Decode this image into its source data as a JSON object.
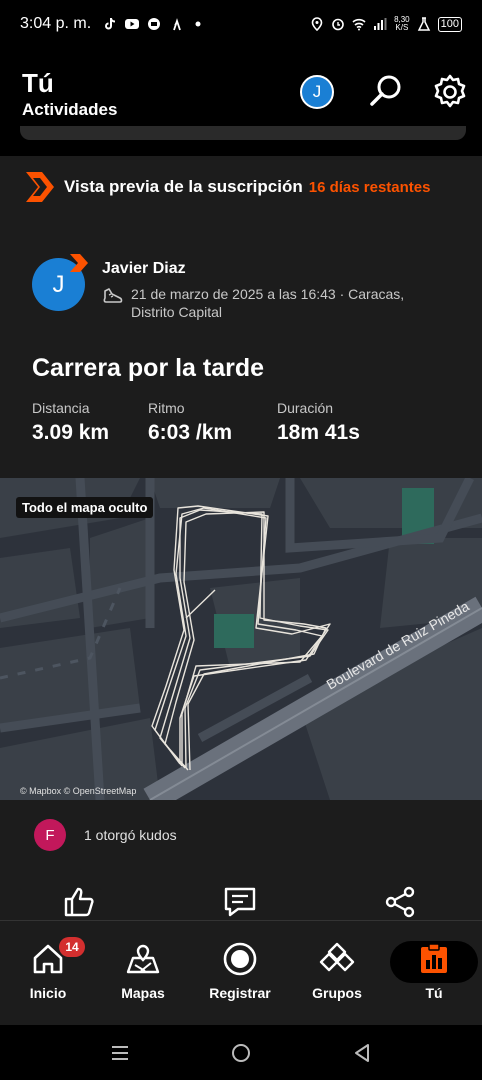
{
  "status_bar": {
    "time": "3:04 p. m.",
    "speed_value": "8,30",
    "speed_unit": "K/S",
    "battery": "100"
  },
  "header": {
    "title": "Tú",
    "subtitle": "Actividades",
    "avatar_initial": "J"
  },
  "promo": {
    "text": "Vista previa de la suscripción",
    "days": "16 días restantes"
  },
  "activity": {
    "athlete_initial": "J",
    "athlete_name": "Javier Diaz",
    "meta": "21 de marzo de 2025 a las 16:43 · Caracas, Distrito Capital",
    "title": "Carrera por la tarde",
    "stats": [
      {
        "label": "Distancia",
        "value": "3.09 km"
      },
      {
        "label": "Ritmo",
        "value": "6:03 /km"
      },
      {
        "label": "Duración",
        "value": "18m 41s"
      }
    ],
    "map_badge": "Todo el mapa oculto",
    "street_label": "Boulevard de Ruiz Pineda",
    "map_attribution": "© Mapbox © OpenStreetMap",
    "kudos_initial": "F",
    "kudos_text": "1 otorgó kudos"
  },
  "nav": {
    "items": [
      {
        "label": "Inicio",
        "icon": "home-icon",
        "badge": "14"
      },
      {
        "label": "Mapas",
        "icon": "map-icon"
      },
      {
        "label": "Registrar",
        "icon": "record-icon"
      },
      {
        "label": "Grupos",
        "icon": "groups-icon"
      },
      {
        "label": "Tú",
        "icon": "you-icon"
      }
    ]
  },
  "colors": {
    "accent": "#fc5200",
    "avatar_blue": "#1a7fd4",
    "kudos_pink": "#c2185b",
    "badge_red": "#d32f2f"
  }
}
